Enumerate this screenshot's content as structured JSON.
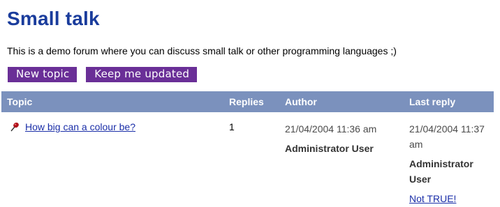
{
  "title": "Small talk",
  "description": "This is a demo forum where you can discuss small talk or other programming languages ;)",
  "buttons": {
    "new_topic": "New topic",
    "keep_updated": "Keep me updated"
  },
  "table": {
    "headers": {
      "topic": "Topic",
      "replies": "Replies",
      "author": "Author",
      "last_reply": "Last reply"
    },
    "rows": [
      {
        "topic": "How big can a colour be?",
        "replies": "1",
        "author_date": "21/04/2004 11:36 am",
        "author_name": "Administrator User",
        "last_date": "21/04/2004 11:37 am",
        "last_name": "Administrator User",
        "last_link": "Not TRUE!"
      }
    ]
  },
  "colors": {
    "title": "#1a3c9c",
    "button_bg": "#6a2f97",
    "header_bg": "#7b91bd",
    "link": "#1a2ea8"
  },
  "icons": {
    "topic_marker": "pin-icon"
  }
}
